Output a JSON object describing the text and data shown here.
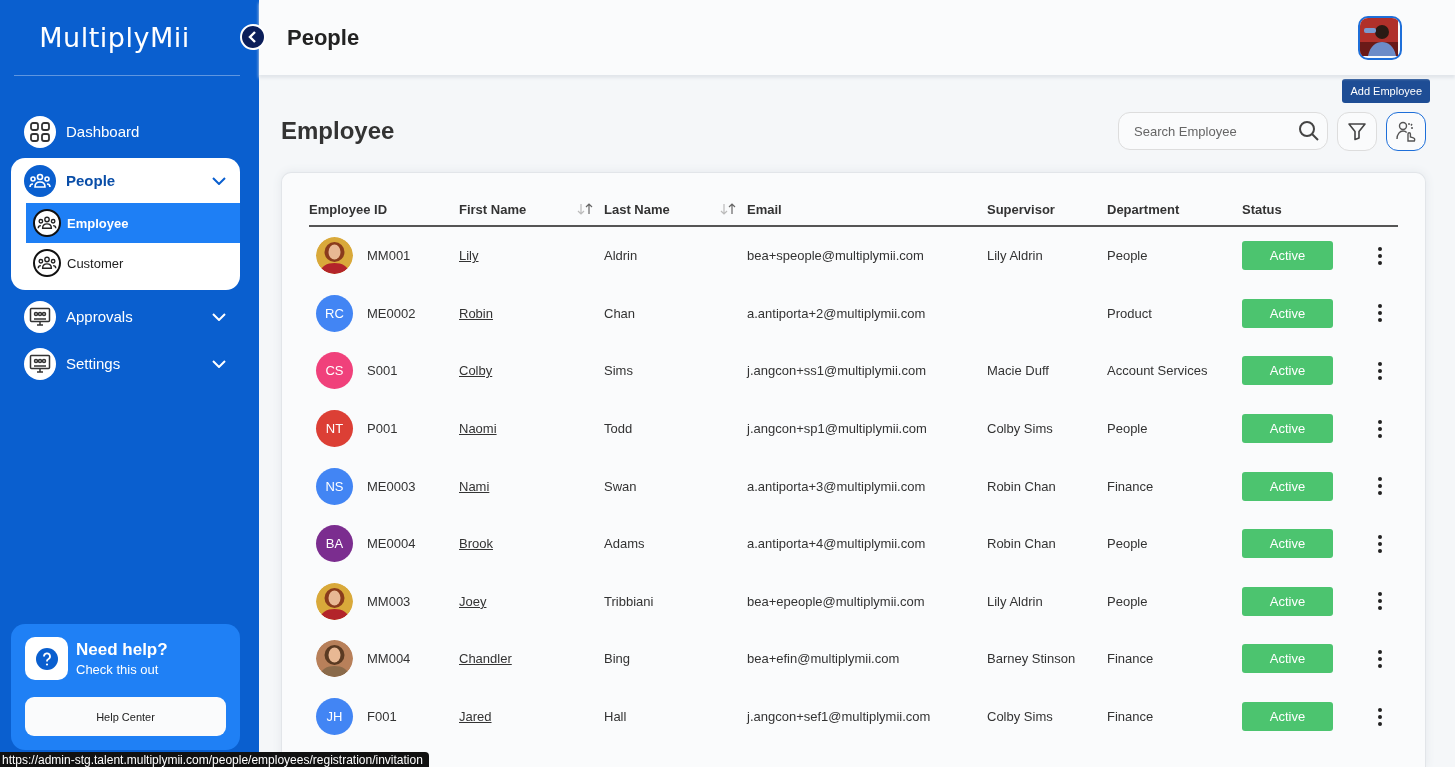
{
  "sidebar": {
    "logo": "MultiplyMii",
    "nav": [
      {
        "label": "Dashboard",
        "expanded": false,
        "has_children": false
      },
      {
        "label": "People",
        "expanded": true,
        "has_children": true,
        "children": [
          {
            "label": "Employee",
            "selected": true
          },
          {
            "label": "Customer",
            "selected": false
          }
        ]
      },
      {
        "label": "Approvals",
        "expanded": false,
        "has_children": true
      },
      {
        "label": "Settings",
        "expanded": false,
        "has_children": true
      }
    ],
    "help": {
      "title": "Need help?",
      "subtitle": "Check this out",
      "button": "Help Center"
    }
  },
  "header": {
    "title": "People"
  },
  "page": {
    "title": "Employee",
    "search": {
      "placeholder": "Search Employee"
    },
    "tooltip": "Add Employee"
  },
  "table": {
    "columns": [
      {
        "label": "Employee ID",
        "sortable": false
      },
      {
        "label": "First Name",
        "sortable": true
      },
      {
        "label": "Last Name",
        "sortable": true
      },
      {
        "label": "Email",
        "sortable": false
      },
      {
        "label": "Supervisor",
        "sortable": false
      },
      {
        "label": "Department",
        "sortable": false
      },
      {
        "label": "Status",
        "sortable": false
      }
    ],
    "rows": [
      {
        "id": "MM001",
        "first_name": "Lily",
        "last_name": "Aldrin",
        "email": "bea+speople@multiplymii.com",
        "supervisor": "Lily Aldrin",
        "department": "People",
        "status": "Active"
      },
      {
        "avatar": {
          "kind": "initials",
          "initials": "RC",
          "color": "#4285f4"
        },
        "id": "ME0002",
        "first_name": "Robin",
        "last_name": "Chan",
        "email": "a.antiporta+2@multiplymii.com",
        "department": "Product",
        "status": "Active"
      },
      {
        "avatar": {
          "kind": "initials",
          "initials": "CS",
          "color": "#f0417b"
        },
        "id": "S001",
        "first_name": "Colby",
        "last_name": "Sims",
        "email": "j.angcon+ss1@multiplymii.com",
        "supervisor": "Macie Duff",
        "department": "Account Services",
        "status": "Active"
      },
      {
        "avatar": {
          "kind": "initials",
          "initials": "NT",
          "color": "#dc3f35"
        },
        "id": "P001",
        "first_name": "Naomi",
        "last_name": "Todd",
        "email": "j.angcon+sp1@multiplymii.com",
        "supervisor": "Colby Sims",
        "department": "People",
        "status": "Active"
      },
      {
        "avatar": {
          "kind": "initials",
          "initials": "NS",
          "color": "#4285f4"
        },
        "id": "ME0003",
        "first_name": "Nami",
        "last_name": "Swan",
        "email": "a.antiporta+3@multiplymii.com",
        "supervisor": "Robin Chan",
        "department": "Finance",
        "status": "Active"
      },
      {
        "avatar": {
          "kind": "initials",
          "initials": "BA",
          "color": "#7b2d8f"
        },
        "id": "ME0004",
        "first_name": "Brook",
        "last_name": "Adams",
        "email": "a.antiporta+4@multiplymii.com",
        "supervisor": "Robin Chan",
        "department": "People",
        "status": "Active"
      },
      {
        "id": "MM003",
        "first_name": "Joey",
        "last_name": "Tribbiani",
        "email": "bea+epeople@multiplymii.com",
        "supervisor": "Lily Aldrin",
        "department": "People",
        "status": "Active"
      },
      {
        "id": "MM004",
        "first_name": "Chandler",
        "last_name": "Bing",
        "email": "bea+efin@multiplymii.com",
        "supervisor": "Barney Stinson",
        "department": "Finance",
        "status": "Active"
      },
      {
        "avatar": {
          "kind": "initials",
          "initials": "JH",
          "color": "#4285f4"
        },
        "id": "F001",
        "first_name": "Jared",
        "last_name": "Hall",
        "email": "j.angcon+sef1@multiplymii.com",
        "supervisor": "Colby Sims",
        "department": "Finance",
        "status": "Active"
      }
    ]
  },
  "status_url": "https://admin-stg.talent.multiplymii.com/people/employees/registration/invitation"
}
